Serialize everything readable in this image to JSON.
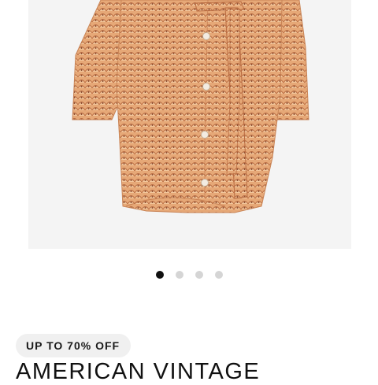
{
  "product": {
    "image_alt": "Patterned wrap shirt dress",
    "image_background": "#f4f4f4",
    "fabric_color": "#e3a574",
    "button_color": "#f3ece2"
  },
  "carousel": {
    "dots": 4,
    "active_index": 0,
    "active_color": "#111111",
    "inactive_color": "#d5d5d5"
  },
  "promo": {
    "label": "UP TO 70% OFF"
  },
  "brand": {
    "name": "AMERICAN VINTAGE"
  }
}
